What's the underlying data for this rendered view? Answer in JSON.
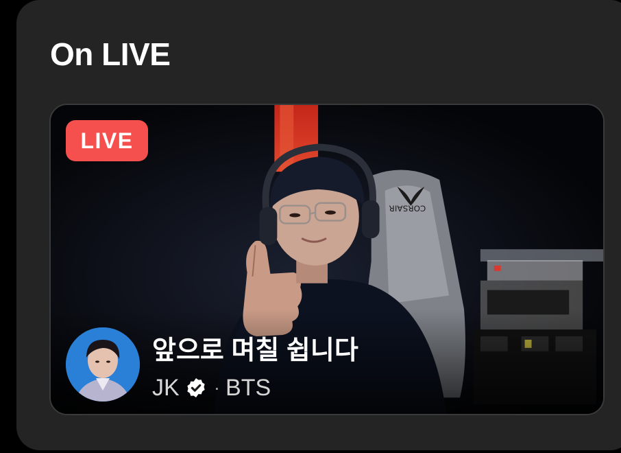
{
  "section": {
    "title": "On LIVE"
  },
  "live_card": {
    "badge": "LIVE",
    "title": "앞으로 며칠 쉽니다",
    "artist_name": "JK",
    "group": "BTS",
    "separator": "·",
    "chair_brand": "CORSAIR",
    "icons": {
      "verified": "verified-badge-icon",
      "avatar": "artist-avatar"
    },
    "colors": {
      "live_badge": "#f5504d",
      "panel_bg": "#242424",
      "text_primary": "#ffffff",
      "text_secondary": "#d6d6d6"
    }
  }
}
